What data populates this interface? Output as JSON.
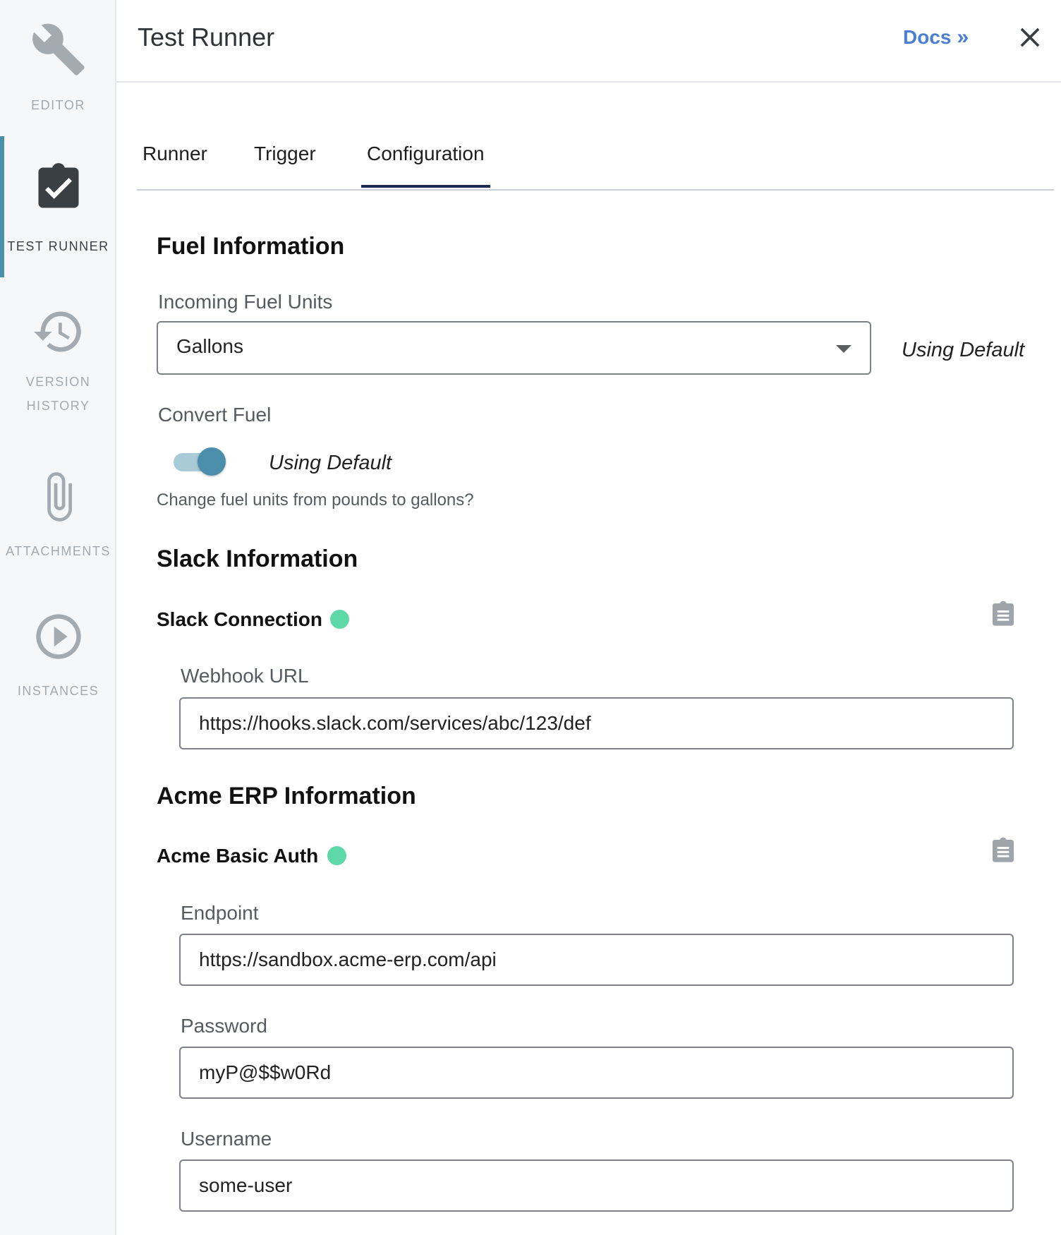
{
  "sidebar": {
    "items": [
      {
        "label": "EDITOR",
        "icon": "wrench-icon"
      },
      {
        "label": "TEST RUNNER",
        "icon": "clipboard-check-icon",
        "active": true
      },
      {
        "label_line1": "VERSION",
        "label_line2": "HISTORY",
        "icon": "history-icon"
      },
      {
        "label": "ATTACHMENTS",
        "icon": "paperclip-icon"
      },
      {
        "label": "INSTANCES",
        "icon": "play-circle-icon"
      }
    ]
  },
  "header": {
    "title": "Test Runner",
    "docs_label": "Docs",
    "docs_chevron": "»"
  },
  "tabs": [
    "Runner",
    "Trigger",
    "Configuration"
  ],
  "active_tab": "Configuration",
  "fuel": {
    "section_title": "Fuel Information",
    "units_label": "Incoming Fuel Units",
    "units_value": "Gallons",
    "units_default_note": "Using Default",
    "convert_label": "Convert Fuel",
    "convert_on": true,
    "convert_default_note": "Using Default",
    "convert_help": "Change fuel units from pounds to gallons?"
  },
  "slack": {
    "section_title": "Slack Information",
    "connection_name": "Slack Connection",
    "webhook_label": "Webhook URL",
    "webhook_value": "https://hooks.slack.com/services/abc/123/def"
  },
  "acme": {
    "section_title": "Acme ERP Information",
    "connection_name": "Acme Basic Auth",
    "endpoint_label": "Endpoint",
    "endpoint_value": "https://sandbox.acme-erp.com/api",
    "password_label": "Password",
    "password_value": "myP@$$w0Rd",
    "username_label": "Username",
    "username_value": "some-user"
  },
  "colors": {
    "status_ok": "#5dd8a6",
    "accent": "#4a8eab",
    "link": "#4a7fd4",
    "tab_indicator": "#1d2b55"
  }
}
